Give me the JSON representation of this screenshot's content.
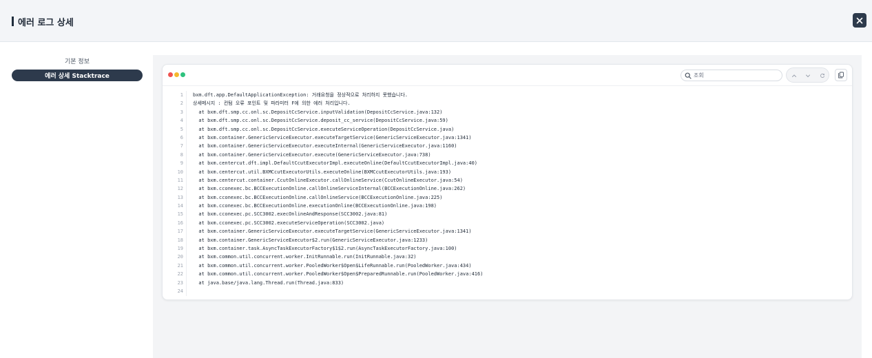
{
  "header": {
    "title": "에러 로그 상세"
  },
  "sidebar": {
    "section_label": "기본 정보",
    "tab_label": "에러 상세 Stacktrace"
  },
  "toolbar": {
    "search_placeholder": "조회",
    "dots": [
      "#ef5350",
      "#f5b82e",
      "#2ec27e"
    ]
  },
  "code": {
    "lines": [
      "bxm.dft.app.DefaultApplicationException: 거래요청을 정상적으로 처리하지 못했습니다.",
      "상세메시지 : 컨텀 오류 포인트 및 파라미터 F에 의한 에러 처리입니다.",
      "  at bxm.dft.smp.cc.onl.sc.DepositCcService.inputValidation(DepositCcService.java:132)",
      "  at bxm.dft.smp.cc.onl.sc.DepositCcService.deposit_cc_service(DepositCcService.java:59)",
      "  at bxm.dft.smp.cc.onl.sc.DepositCcService.executeServiceOperation(DepositCcService.java)",
      "  at bxm.container.GenericServiceExecutor.executeTargetService(GenericServiceExecutor.java:1341)",
      "  at bxm.container.GenericServiceExecutor.executeInternal(GenericServiceExecutor.java:1160)",
      "  at bxm.container.GenericServiceExecutor.execute(GenericServiceExecutor.java:738)",
      "  at bxm.centercut.dft.impl.DefaultCcutExecutorImpl.executeOnline(DefaultCcutExecutorImpl.java:40)",
      "  at bxm.centercut.util.BXMCcutExecutorUtils.executeOnline(BXMCcutExecutorUtils.java:193)",
      "  at bxm.centercut.container.CcutOnlineExecutor.callOnlineService(CcutOnlineExecutor.java:54)",
      "  at bxm.cconexec.bc.BCCExecutionOnline.callOnlineServiceInternal(BCCExecutionOnline.java:262)",
      "  at bxm.cconexec.bc.BCCExecutionOnline.callOnlineService(BCCExecutionOnline.java:225)",
      "  at bxm.cconexec.bc.BCCExecutionOnline.executionOnline(BCCExecutionOnline.java:198)",
      "  at bxm.cconexec.pc.SCC3002.execOnlineAndResponse(SCC3002.java:81)",
      "  at bxm.cconexec.pc.SCC3002.executeServiceOperation(SCC3002.java)",
      "  at bxm.container.GenericServiceExecutor.executeTargetService(GenericServiceExecutor.java:1341)",
      "  at bxm.container.GenericServiceExecutor$2.run(GenericServiceExecutor.java:1233)",
      "  at bxm.container.task.AsyncTaskExecutorFactory$1$2.run(AsyncTaskExecutorFactory.java:100)",
      "  at bxm.common.util.concurrent.worker.InitRunnable.run(InitRunnable.java:32)",
      "  at bxm.common.util.concurrent.worker.PooledWorker$Open$LifeRunnable.run(PooledWorker.java:434)",
      "  at bxm.common.util.concurrent.worker.PooledWorker$Open$PreparedRunnable.run(PooledWorker.java:416)",
      "  at java.base/java.lang.Thread.run(Thread.java:833)",
      ""
    ]
  }
}
